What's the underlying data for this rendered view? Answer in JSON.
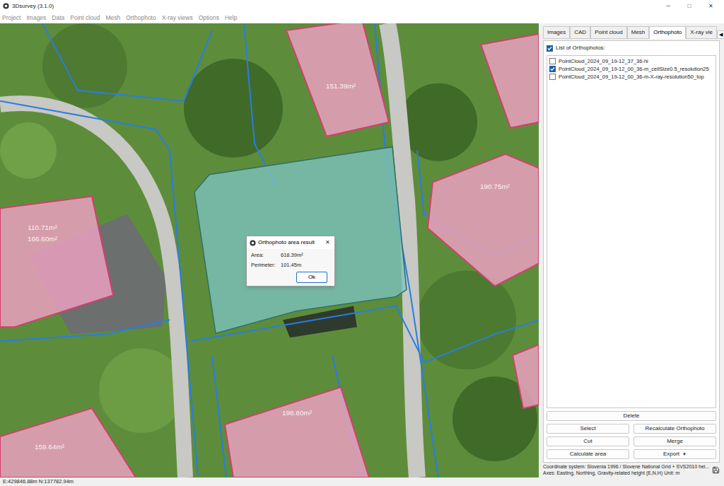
{
  "window": {
    "title": "3Dsurvey (3.1.0)",
    "controls": [
      "─",
      "□",
      "✕"
    ]
  },
  "menu": [
    "Project",
    "Images",
    "Data",
    "Point cloud",
    "Mesh",
    "Orthophoto",
    "X-ray views",
    "Options",
    "Help"
  ],
  "map": {
    "buildings": [
      {
        "labels": [
          "151.39m²"
        ]
      },
      {
        "labels": [
          "110.71m²",
          "166.60m²"
        ]
      },
      {
        "labels": [
          "190.75m²"
        ]
      },
      {
        "labels": []
      },
      {
        "labels": [
          "198.80m²"
        ]
      },
      {
        "labels": [
          "159.64m²"
        ]
      },
      {
        "labels": []
      }
    ],
    "area_selected": true
  },
  "dialog": {
    "title": "Orthophoto area result",
    "close": "✕",
    "rows": [
      {
        "label": "Area:",
        "value": "618.39m²"
      },
      {
        "label": "Perimeter:",
        "value": "101.45m"
      }
    ],
    "button": "Ok"
  },
  "panel": {
    "tabs": [
      {
        "label": "Images",
        "selected": false
      },
      {
        "label": "CAD",
        "selected": false
      },
      {
        "label": "Point cloud",
        "selected": false
      },
      {
        "label": "Mesh",
        "selected": false
      },
      {
        "label": "Orthophoto",
        "selected": true
      },
      {
        "label": "X-ray vie",
        "selected": false
      }
    ],
    "tab_scroll": [
      "◀",
      "▶"
    ],
    "list_header": {
      "label": "List of Orthophotos:",
      "checked": true
    },
    "orthophotos": [
      {
        "name": "PointCloud_2024_09_19-12_37_36-hi",
        "checked": false
      },
      {
        "name": "PointCloud_2024_09_19-12_00_36-m_cellSize0.5_resolution25",
        "checked": true
      },
      {
        "name": "PointCloud_2024_09_19-12_00_36-m-X-ray-resolution50_top",
        "checked": false
      }
    ],
    "buttons": [
      [
        {
          "label": "Delete",
          "dropdown": ""
        }
      ],
      [
        {
          "label": "Select",
          "dropdown": ""
        },
        {
          "label": "Recalculate Orthophoto",
          "dropdown": ""
        }
      ],
      [
        {
          "label": "Cut",
          "dropdown": ""
        },
        {
          "label": "Merge",
          "dropdown": ""
        }
      ],
      [
        {
          "label": "Calculate area",
          "dropdown": ""
        },
        {
          "label": "Export",
          "dropdown": "▼"
        }
      ]
    ],
    "coordinate_info": [
      "Coordinate system: Slovenia 1996 / Slovene National Grid + SVS2010 hei...",
      "Axes: Easting, Northing, Gravity-related height (E,N,H) Unit: m"
    ]
  },
  "status_bar": {
    "coordinates": "E:429846.88m N:137782.94m"
  }
}
